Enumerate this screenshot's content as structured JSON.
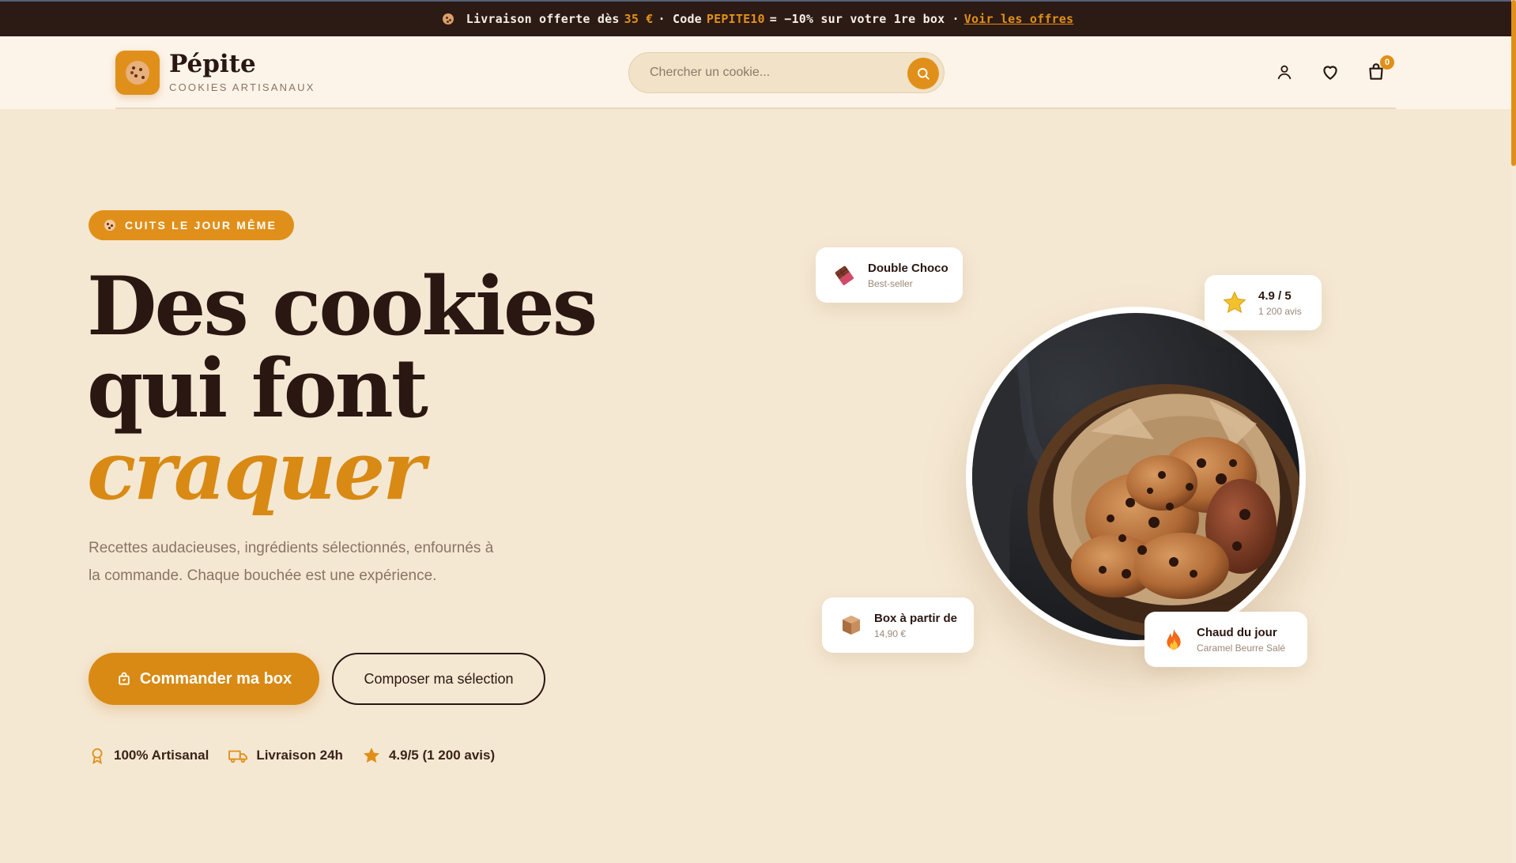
{
  "announcement": {
    "part1": "Livraison offerte dès",
    "amount": "35 €",
    "part2": "· Code",
    "code": "PEPITE10",
    "part3": "= −10% sur votre 1re box ·",
    "link": "Voir les offres"
  },
  "header": {
    "brand_name": "Pépite",
    "brand_tagline": "COOKIES ARTISANAUX",
    "search_placeholder": "Chercher un cookie...",
    "cart_count": "0"
  },
  "hero": {
    "badge": "CUITS LE JOUR MÊME",
    "title_line1": "Des cookies",
    "title_line2": "qui font",
    "title_accent": "craquer",
    "lead": "Recettes audacieuses, ingrédients sélectionnés, enfournés à la commande. Chaque bouchée est une expérience.",
    "cta_primary": "Commander ma box",
    "cta_secondary": "Composer ma sélection",
    "features": [
      {
        "icon": "award-icon",
        "label": "100% Artisanal"
      },
      {
        "icon": "truck-icon",
        "label": "Livraison 24h"
      },
      {
        "icon": "star-icon",
        "label": "4.9/5 (1 200 avis)"
      }
    ]
  },
  "floating_cards": {
    "double_choco": {
      "title": "Double Choco",
      "subtitle": "Best-seller"
    },
    "rating": {
      "title": "4.9 / 5",
      "subtitle": "1 200 avis"
    },
    "box": {
      "title": "Box à partir de",
      "subtitle": "14,90 €"
    },
    "hot": {
      "title": "Chaud du jour",
      "subtitle": "Caramel Beurre Salé"
    }
  },
  "colors": {
    "accent": "#e0901a",
    "dark": "#2c1a14",
    "background": "#f5e8d3"
  }
}
